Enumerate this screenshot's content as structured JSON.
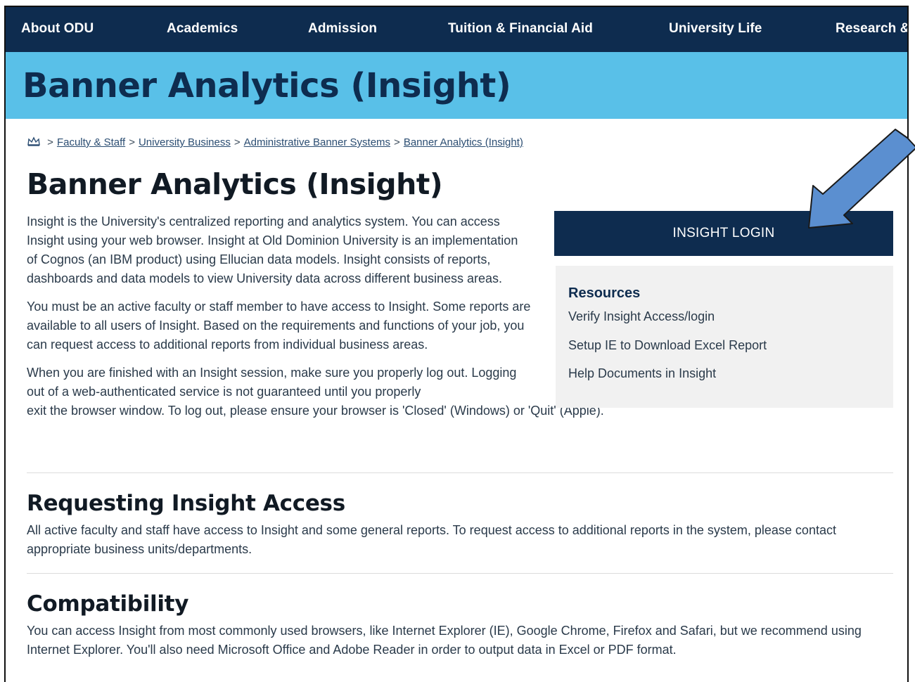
{
  "nav": {
    "items": [
      "About ODU",
      "Academics",
      "Admission",
      "Tuition & Financial Aid",
      "University Life",
      "Research &"
    ]
  },
  "banner": {
    "title": "Banner Analytics (Insight)"
  },
  "breadcrumb": {
    "home_icon": "crown-home-icon",
    "links": [
      "Faculty & Staff",
      "University Business",
      "Administrative Banner Systems",
      "Banner Analytics (Insight)"
    ],
    "separator": ">"
  },
  "page": {
    "title": "Banner Analytics (Insight)",
    "paragraphs": [
      "Insight is the University's centralized reporting and analytics system. You can access Insight using your web browser. Insight at Old Dominion University is an implementation of Cognos (an IBM product) using Ellucian data models. Insight consists of reports, dashboards and data models to view University data across different business areas.",
      "You must be an active faculty or staff member to have access to Insight. Some reports are available to all users of Insight. Based on the requirements and functions of your job, you can request access to additional reports from individual business areas.",
      "When you are finished with an Insight session, make sure you properly log out. Logging out of a web-authenticated service is not guaranteed until you properly",
      "exit the browser window. To log out, please ensure your browser is 'Closed' (Windows) or 'Quit' (Apple)."
    ]
  },
  "sidebar": {
    "login_label": "INSIGHT LOGIN",
    "resources_title": "Resources",
    "resources": [
      "Verify Insight Access/login",
      "Setup IE to Download Excel Report",
      "Help Documents in Insight"
    ]
  },
  "sections": [
    {
      "heading": "Requesting Insight Access",
      "body": "All active faculty and staff have access to Insight and some general reports. To request access to additional reports in the system, please contact appropriate business units/departments."
    },
    {
      "heading": "Compatibility",
      "body": "You can access Insight from most commonly used browsers, like Internet Explorer (IE), Google Chrome, Firefox and Safari, but we recommend using Internet Explorer. You'll also need Microsoft Office and Adobe Reader in order to output data in Excel or PDF format."
    }
  ],
  "colors": {
    "nav_bg": "#0e2c4f",
    "banner_bg": "#59c0e8",
    "arrow": "#5b8fd0"
  }
}
